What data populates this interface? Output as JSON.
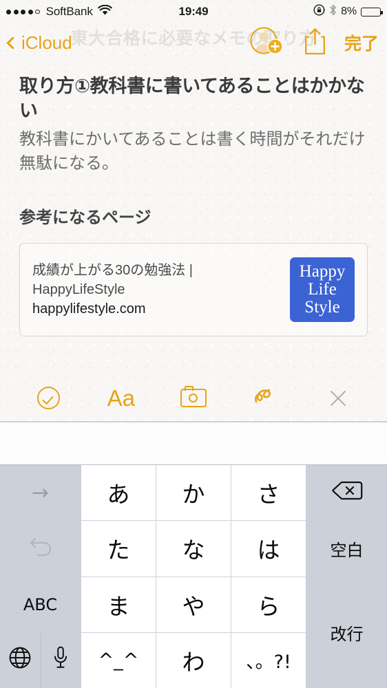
{
  "status_bar": {
    "signal_dots_filled": 4,
    "signal_dots_total": 5,
    "carrier": "SoftBank",
    "wifi_icon": "wifi-icon",
    "time": "19:49",
    "rotation_lock_icon": "rotation-lock-icon",
    "bluetooth_icon": "bluetooth-icon",
    "battery_percent": "8%",
    "battery_level": 8,
    "battery_color": "#fb2d1d"
  },
  "nav": {
    "back_label": "iCloud",
    "back_icon": "chevron-left-icon",
    "ghost_title": "東大合格に必要なメモの取り方",
    "add_person_icon": "add-person-icon",
    "share_icon": "share-icon",
    "done_label": "完了",
    "accent_color": "#e8a317"
  },
  "note": {
    "title": "取り方①教科書に書いてあることはかかない",
    "body": "教科書にかいてあることは書く時間がそれだけ無駄になる。",
    "subheading": "参考になるページ",
    "link_card": {
      "title": "成績が上がる30の勉強法 | HappyLifeStyle",
      "url": "happylifestyle.com",
      "thumbnail_lines": [
        "Happy",
        "Life",
        "Style"
      ],
      "thumbnail_color": "#3c63d4"
    }
  },
  "toolbar": {
    "items": [
      {
        "name": "checklist-icon",
        "label": ""
      },
      {
        "name": "text-format-icon",
        "label": "Aa"
      },
      {
        "name": "camera-icon",
        "label": ""
      },
      {
        "name": "sketch-icon",
        "label": ""
      },
      {
        "name": "close-icon",
        "label": ""
      }
    ]
  },
  "keyboard": {
    "candidate_bar_text": "",
    "keys": {
      "r1c1": "→",
      "r1c2": "あ",
      "r1c3": "か",
      "r1c4": "さ",
      "r1c5": "delete-icon",
      "r2c1": "↺",
      "r2c2": "た",
      "r2c3": "な",
      "r2c4": "は",
      "r2c5": "空白",
      "r3c1": "ABC",
      "r3c2": "ま",
      "r3c3": "や",
      "r3c4": "ら",
      "r3c5": "改行",
      "r4c1a": "globe-icon",
      "r4c1b": "microphone-icon",
      "r4c2": "^_^",
      "r4c3": "わ",
      "r4c4": "、。?!"
    },
    "key_bg": "#ccd1d9",
    "char_key_bg": "#ffffff"
  }
}
